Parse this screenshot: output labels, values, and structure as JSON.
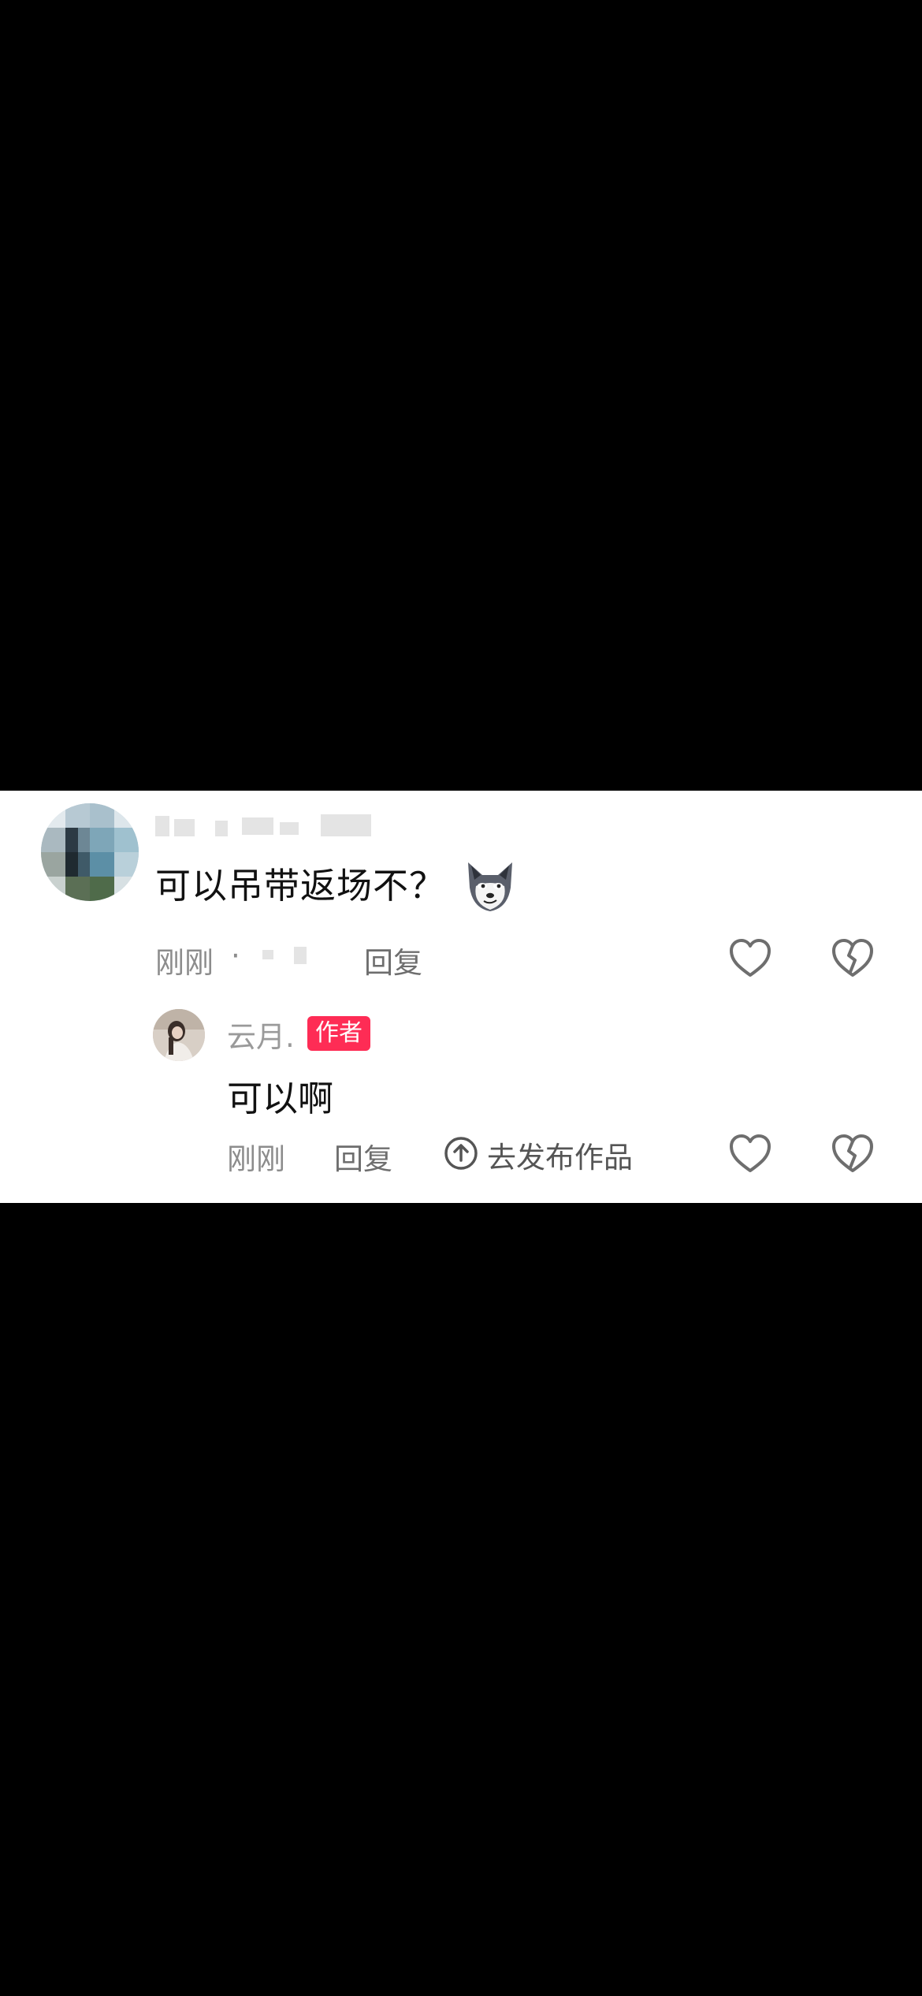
{
  "comment": {
    "text": "可以吊带返场不？",
    "emoji": "wolf-face-emoji",
    "time": "刚刚",
    "separator": "·",
    "reply_label": "回复"
  },
  "reply": {
    "author_name": "云月.",
    "author_badge": "作者",
    "text": "可以啊",
    "time": "刚刚",
    "reply_label": "回复",
    "publish_label": "去发布作品"
  },
  "icons": {
    "like": "heart-outline-icon",
    "dislike": "broken-heart-icon",
    "publish": "arrow-up-circle-icon"
  },
  "colors": {
    "page_background": "#000000",
    "panel_background": "#ffffff",
    "author_badge": "#fe2c55",
    "meta_text": "#8c8c8c"
  }
}
